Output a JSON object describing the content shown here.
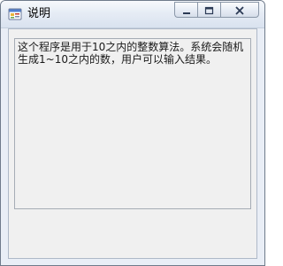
{
  "window": {
    "title": "说明"
  },
  "icons": {
    "app": "application-form-icon",
    "minimize": "minimize-icon",
    "maximize": "maximize-icon",
    "close": "close-icon"
  },
  "content": {
    "text": "这个程序是用于10之内的整数算法。系统会随机生成1~10之内的数，用户可以输入结果。"
  },
  "colors": {
    "client_background": "#f0f0f0",
    "titlebar_gradient_top": "#f7f9fc",
    "titlebar_gradient_bottom": "#d9e2ef"
  }
}
